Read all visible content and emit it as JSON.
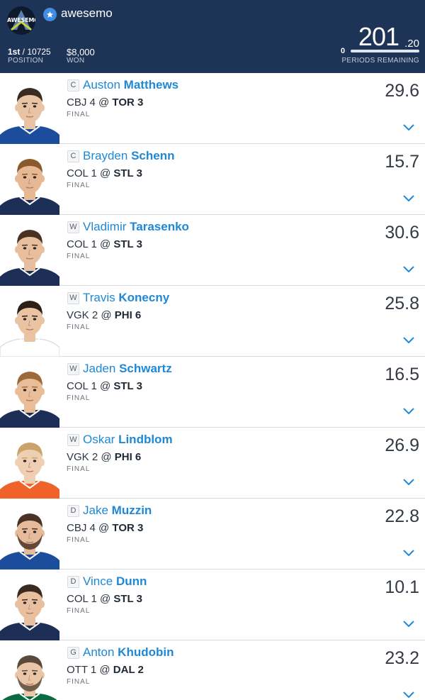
{
  "header": {
    "logo_text": "AWESEMO",
    "username": "awesemo",
    "position_rank": "1st",
    "position_total": " / 10725",
    "position_label": "POSITION",
    "won_value": "$8,000",
    "won_label": "WON",
    "score_integer": "201",
    "score_decimal": ".20",
    "periods_remaining_count": "0",
    "periods_remaining_progress": 1.0,
    "periods_label": "PERIODS REMAINING",
    "accent_color": "#3f8ee3",
    "background_color": "#1e3456"
  },
  "players": [
    {
      "pos": "C",
      "first": "Auston",
      "last": "Matthews",
      "away": "CBJ 4",
      "at": " @ ",
      "home": "TOR 3",
      "status": "FINAL",
      "points": "29.6",
      "jersey": "#1c4d9c",
      "hair": "#3a2b20",
      "skin": "#e8c3a4",
      "beard": false
    },
    {
      "pos": "C",
      "first": "Brayden",
      "last": "Schenn",
      "away": "COL 1",
      "at": " @ ",
      "home": "STL 3",
      "status": "FINAL",
      "points": "15.7",
      "jersey": "#1d2f56",
      "hair": "#8b5a2b",
      "skin": "#e6b894",
      "beard": false
    },
    {
      "pos": "W",
      "first": "Vladimir",
      "last": "Tarasenko",
      "away": "COL 1",
      "at": " @ ",
      "home": "STL 3",
      "status": "FINAL",
      "points": "30.6",
      "jersey": "#1d2f56",
      "hair": "#4a3222",
      "skin": "#e7bf9e",
      "beard": false
    },
    {
      "pos": "W",
      "first": "Travis",
      "last": "Konecny",
      "away": "VGK 2",
      "at": " @ ",
      "home": "PHI 6",
      "status": "FINAL",
      "points": "25.8",
      "jersey": "#ffffff",
      "hair": "#2c1f17",
      "skin": "#eac3a3",
      "beard": false
    },
    {
      "pos": "W",
      "first": "Jaden",
      "last": "Schwartz",
      "away": "COL 1",
      "at": " @ ",
      "home": "STL 3",
      "status": "FINAL",
      "points": "16.5",
      "jersey": "#1d2f56",
      "hair": "#9a6a3a",
      "skin": "#e8bd98",
      "beard": false
    },
    {
      "pos": "W",
      "first": "Oskar",
      "last": "Lindblom",
      "away": "VGK 2",
      "at": " @ ",
      "home": "PHI 6",
      "status": "FINAL",
      "points": "26.9",
      "jersey": "#f0622a",
      "hair": "#c9a36a",
      "skin": "#efcfb2",
      "beard": false
    },
    {
      "pos": "D",
      "first": "Jake",
      "last": "Muzzin",
      "away": "CBJ 4",
      "at": " @ ",
      "home": "TOR 3",
      "status": "FINAL",
      "points": "22.8",
      "jersey": "#1c4d9c",
      "hair": "#4a3224",
      "skin": "#e6bb9b",
      "beard": true
    },
    {
      "pos": "D",
      "first": "Vince",
      "last": "Dunn",
      "away": "COL 1",
      "at": " @ ",
      "home": "STL 3",
      "status": "FINAL",
      "points": "10.1",
      "jersey": "#1d2f56",
      "hair": "#3a2a20",
      "skin": "#e8c0a0",
      "beard": false
    },
    {
      "pos": "G",
      "first": "Anton",
      "last": "Khudobin",
      "away": "OTT 1",
      "at": " @ ",
      "home": "DAL 2",
      "status": "FINAL",
      "points": "23.2",
      "jersey": "#0b6a3f",
      "hair": "#5a4a3a",
      "skin": "#eac6a8",
      "beard": true
    }
  ],
  "icons": {
    "star": "star-icon",
    "expand": "chevron-down-icon"
  }
}
